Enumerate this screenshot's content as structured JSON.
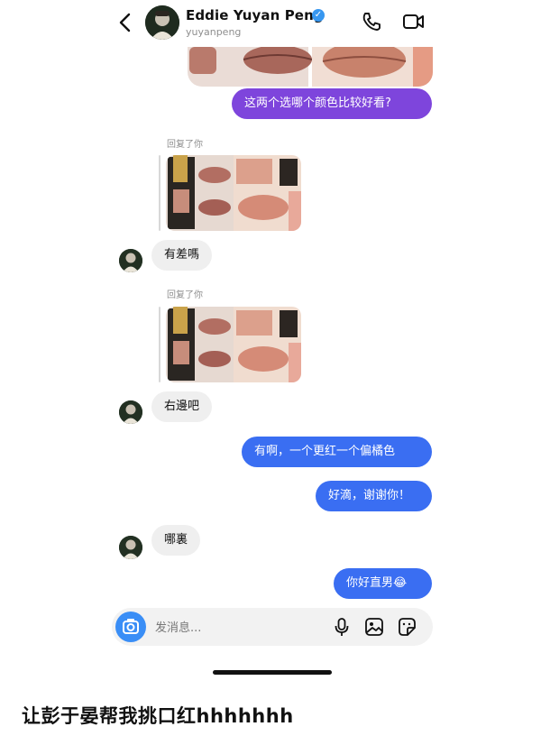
{
  "header": {
    "title": "Eddie Yuyan Peng",
    "handle": "yuyanpeng",
    "verified_mark": "✓"
  },
  "icons": {
    "back": "chevron-left-icon",
    "phone": "phone-icon",
    "video": "video-camera-icon",
    "camera": "camera-icon",
    "mic": "microphone-icon",
    "gallery": "image-icon",
    "sticker": "sticker-icon"
  },
  "messages": {
    "m1": "这两个选哪个颜色比较好看?",
    "reply1_label": "回复了你",
    "m2": "有差嗎",
    "reply2_label": "回复了你",
    "m3": "右邊吧",
    "m4": "有啊，一个更红一个偏橘色",
    "m5": "好滴，谢谢你！",
    "m6": "哪裏",
    "m7": "你好直男😂"
  },
  "composer": {
    "placeholder": "发消息..."
  },
  "caption": "让彭于晏帮我挑口红hhhhhhh",
  "colors": {
    "purple_bubble": "#7e45dc",
    "blue_bubble": "#3a6ef2",
    "gray_bubble": "#efefef",
    "verified": "#3797f0",
    "camera": "#3a8ef6"
  }
}
